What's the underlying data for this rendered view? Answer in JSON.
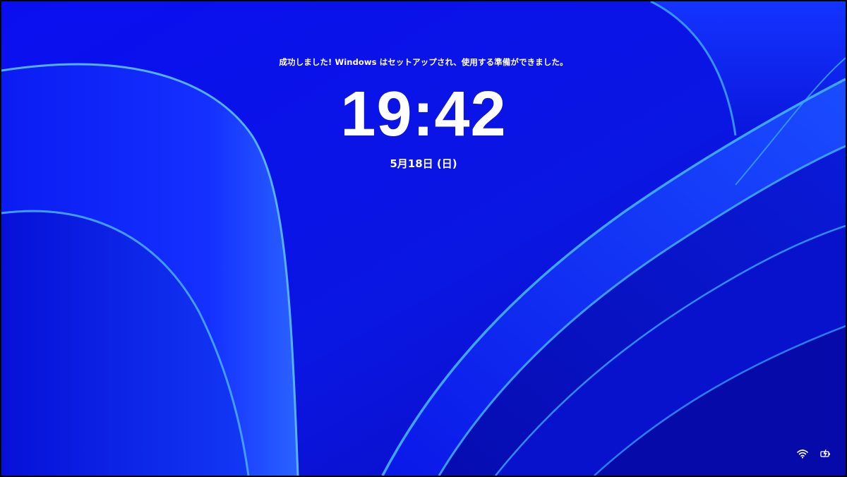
{
  "lock_screen": {
    "notice": "成功しました! Windows はセットアップされ、使用する準備ができました。",
    "time": "19:42",
    "date": "5月18日 (日)"
  },
  "status_icons": {
    "network": "wifi-icon",
    "power": "battery-charging-icon"
  },
  "colors": {
    "background": "#0a14e6",
    "ribbon_highlight": "#3ea6ff",
    "text": "#ffffff"
  }
}
